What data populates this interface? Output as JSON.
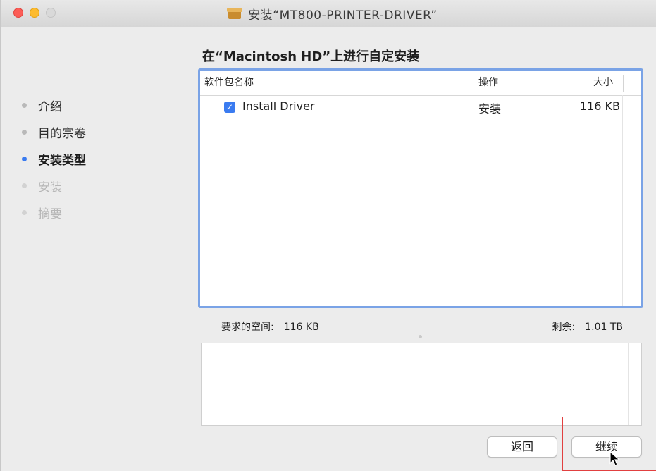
{
  "window": {
    "title": "安装“MT800-PRINTER-DRIVER”"
  },
  "sidebar": {
    "steps": [
      {
        "label": "介绍",
        "state": "done"
      },
      {
        "label": "目的宗卷",
        "state": "done"
      },
      {
        "label": "安装类型",
        "state": "active"
      },
      {
        "label": "安装",
        "state": "pending"
      },
      {
        "label": "摘要",
        "state": "pending"
      }
    ]
  },
  "main": {
    "heading": "在“Macintosh HD”上进行自定安装",
    "table": {
      "columns": [
        "软件包名称",
        "操作",
        "大小"
      ],
      "rows": [
        {
          "checked": true,
          "name": "Install Driver",
          "action": "安装",
          "size": "116 KB"
        }
      ]
    },
    "space": {
      "required_label": "要求的空间:",
      "required_value": "116 KB",
      "remaining_label": "剩余:",
      "remaining_value": "1.01 TB"
    }
  },
  "buttons": {
    "back": "返回",
    "continue": "继续"
  },
  "colors": {
    "accent": "#3a7bf0",
    "focus_ring": "#7aa3e6",
    "highlight_box": "#e14040"
  }
}
